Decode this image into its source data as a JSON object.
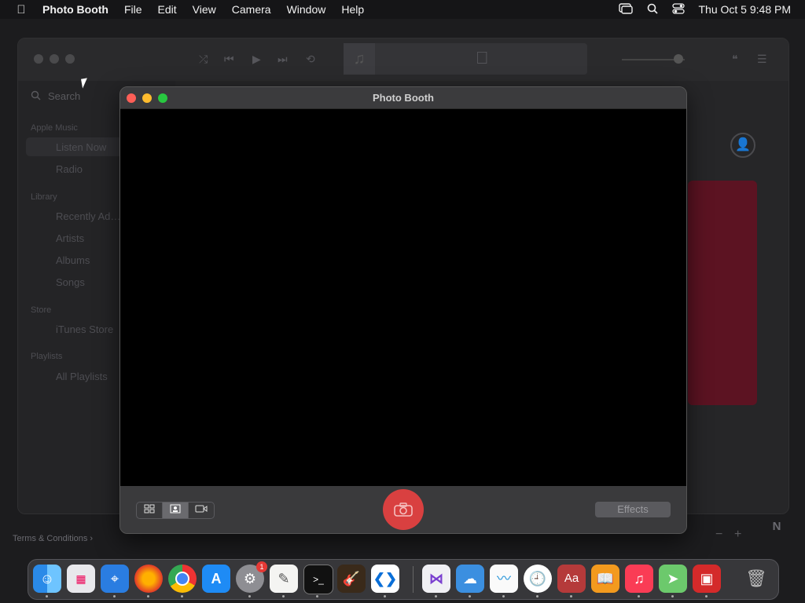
{
  "menubar": {
    "apple_icon": "",
    "app_name": "Photo Booth",
    "items": [
      "File",
      "Edit",
      "View",
      "Camera",
      "Window",
      "Help"
    ],
    "clock": "Thu Oct 5  9:48 PM"
  },
  "music": {
    "search_placeholder": "Search",
    "sections": {
      "apple_music": "Apple Music",
      "library": "Library",
      "store": "Store",
      "playlists": "Playlists"
    },
    "items": {
      "listen_now": "Listen Now",
      "radio": "Radio",
      "recently_added": "Recently Ad…",
      "artists": "Artists",
      "albums": "Albums",
      "songs": "Songs",
      "itunes_store": "iTunes Store",
      "all_playlists": "All Playlists"
    },
    "terms": "Terms & Conditions ›"
  },
  "photobooth": {
    "title": "Photo Booth",
    "effects_label": "Effects",
    "view_modes": [
      "grid-4-icon",
      "single-photo-icon",
      "video-icon"
    ],
    "selected_mode": "single-photo-icon"
  },
  "dock": {
    "apps": [
      "Finder",
      "Launchpad",
      "Safari",
      "Firefox",
      "Chrome",
      "App Store",
      "System Settings",
      "TextEdit",
      "Terminal",
      "GarageBand",
      "VS Code",
      "Visual Studio",
      "Weather",
      "Freeform",
      "Clock",
      "Dictionary",
      "Books",
      "Music",
      "Maps",
      "Photo Booth",
      "Trash"
    ],
    "settings_badge": "1"
  },
  "map_zoom": {
    "minus": "−",
    "plus": "+",
    "compass": "N"
  },
  "colors": {
    "shutter": "#d94040",
    "accent_red": "#5c1322"
  }
}
